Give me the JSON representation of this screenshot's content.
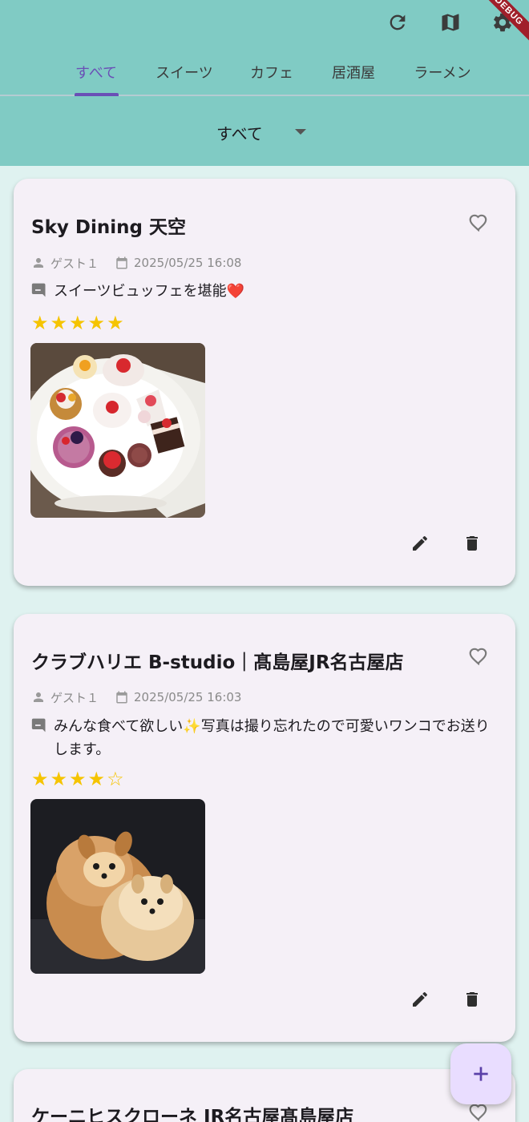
{
  "appbar": {
    "debug_label": "DEBUG",
    "background": "#80cbc4",
    "icons": [
      "refresh-icon",
      "map-icon",
      "settings-icon"
    ]
  },
  "tabs": [
    {
      "label": "すべて",
      "active": true
    },
    {
      "label": "スイーツ",
      "active": false
    },
    {
      "label": "カフェ",
      "active": false
    },
    {
      "label": "居酒屋",
      "active": false
    },
    {
      "label": "ラーメン",
      "active": false
    }
  ],
  "filter": {
    "selected": "すべて"
  },
  "posts": [
    {
      "title": "Sky Dining 天空",
      "user": "ゲスト１",
      "datetime": "2025/05/25 16:08",
      "comment": "スイーツビュッフェを堪能❤️",
      "rating": 5,
      "stars": "★★★★★",
      "photo": "sweets-buffet-plate"
    },
    {
      "title": "クラブハリエ B-studio｜髙島屋JR名古屋店",
      "user": "ゲスト１",
      "datetime": "2025/05/25 16:03",
      "comment": "みんな食べて欲しい✨写真は撮り忘れたので可愛いワンコでお送りします。",
      "rating": 4,
      "stars": "★★★★☆",
      "photo": "pomeranian-dogs"
    },
    {
      "title": "ケーニヒスクローネ JR名古屋髙島屋店"
    }
  ],
  "colors": {
    "accent": "#6a4fb6",
    "star": "#f5c400",
    "card": "#f5f0f7",
    "fab": "#e9ddff"
  }
}
